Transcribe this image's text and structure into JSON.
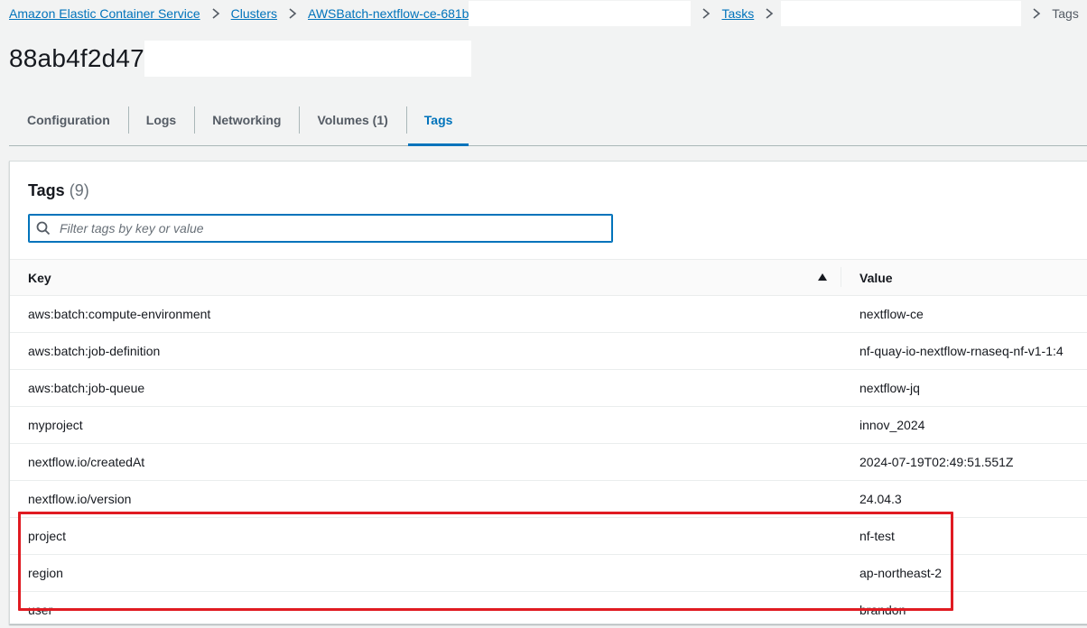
{
  "breadcrumb": {
    "items": [
      {
        "label": "Amazon Elastic Container Service",
        "link": true
      },
      {
        "label": "Clusters",
        "link": true
      },
      {
        "label": "AWSBatch-nextflow-ce-681b",
        "link": true
      },
      {
        "label": "Tasks",
        "link": true
      },
      {
        "label": "Tags",
        "link": false
      }
    ]
  },
  "page": {
    "title": "88ab4f2d47"
  },
  "tabs": [
    {
      "label": "Configuration",
      "active": false
    },
    {
      "label": "Logs",
      "active": false
    },
    {
      "label": "Networking",
      "active": false
    },
    {
      "label": "Volumes (1)",
      "active": false
    },
    {
      "label": "Tags",
      "active": true
    }
  ],
  "tags_panel": {
    "title": "Tags",
    "count": "(9)",
    "filter_placeholder": "Filter tags by key or value",
    "filter_value": "",
    "columns": {
      "key": "Key",
      "value": "Value"
    },
    "rows": [
      {
        "key": "aws:batch:compute-environment",
        "value": "nextflow-ce"
      },
      {
        "key": "aws:batch:job-definition",
        "value": "nf-quay-io-nextflow-rnaseq-nf-v1-1:4"
      },
      {
        "key": "aws:batch:job-queue",
        "value": "nextflow-jq"
      },
      {
        "key": "myproject",
        "value": "innov_2024"
      },
      {
        "key": "nextflow.io/createdAt",
        "value": "2024-07-19T02:49:51.551Z"
      },
      {
        "key": "nextflow.io/version",
        "value": "24.04.3"
      },
      {
        "key": "project",
        "value": "nf-test"
      },
      {
        "key": "region",
        "value": "ap-northeast-2"
      },
      {
        "key": "user",
        "value": "brandon"
      }
    ]
  },
  "colors": {
    "link": "#0073bb",
    "highlight": "#e01b22",
    "background": "#f2f3f3"
  },
  "icons": {
    "breadcrumb_separator": "chevron-right-icon",
    "search": "search-icon",
    "sort": "sort-ascending-icon"
  }
}
